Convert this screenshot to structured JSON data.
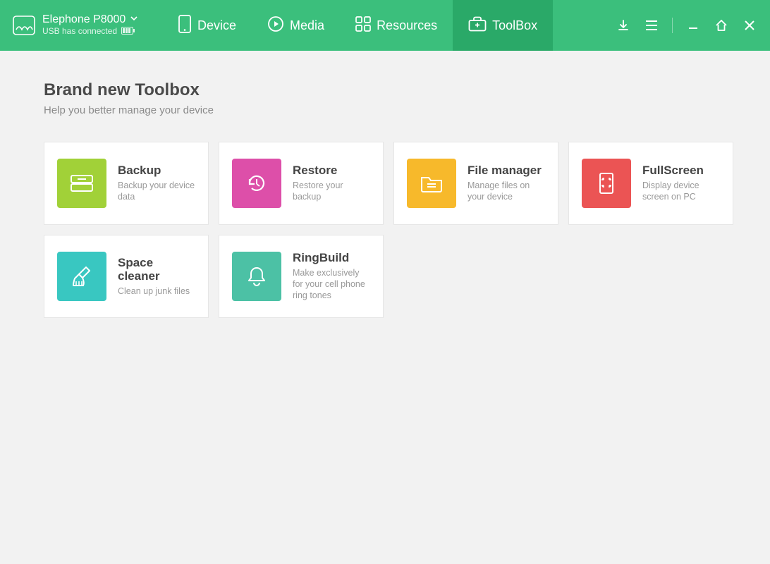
{
  "header": {
    "device_name": "Elephone P8000",
    "connection_status": "USB has connected",
    "nav": [
      {
        "label": "Device"
      },
      {
        "label": "Media"
      },
      {
        "label": "Resources"
      },
      {
        "label": "ToolBox"
      }
    ]
  },
  "page": {
    "title": "Brand new Toolbox",
    "subtitle": "Help you better manage your device"
  },
  "tools": [
    {
      "title": "Backup",
      "desc": "Backup your device data",
      "color": "green",
      "icon": "backup"
    },
    {
      "title": "Restore",
      "desc": "Restore your backup",
      "color": "pink",
      "icon": "restore"
    },
    {
      "title": "File manager",
      "desc": "Manage files on your device",
      "color": "amber",
      "icon": "folder"
    },
    {
      "title": "FullScreen",
      "desc": "Display device screen on PC",
      "color": "red",
      "icon": "fullscreen"
    },
    {
      "title": "Space cleaner",
      "desc": "Clean up junk files",
      "color": "cyan",
      "icon": "brush"
    },
    {
      "title": "RingBuild",
      "desc": "Make exclusively for your cell phone ring tones",
      "color": "teal",
      "icon": "bell"
    }
  ]
}
